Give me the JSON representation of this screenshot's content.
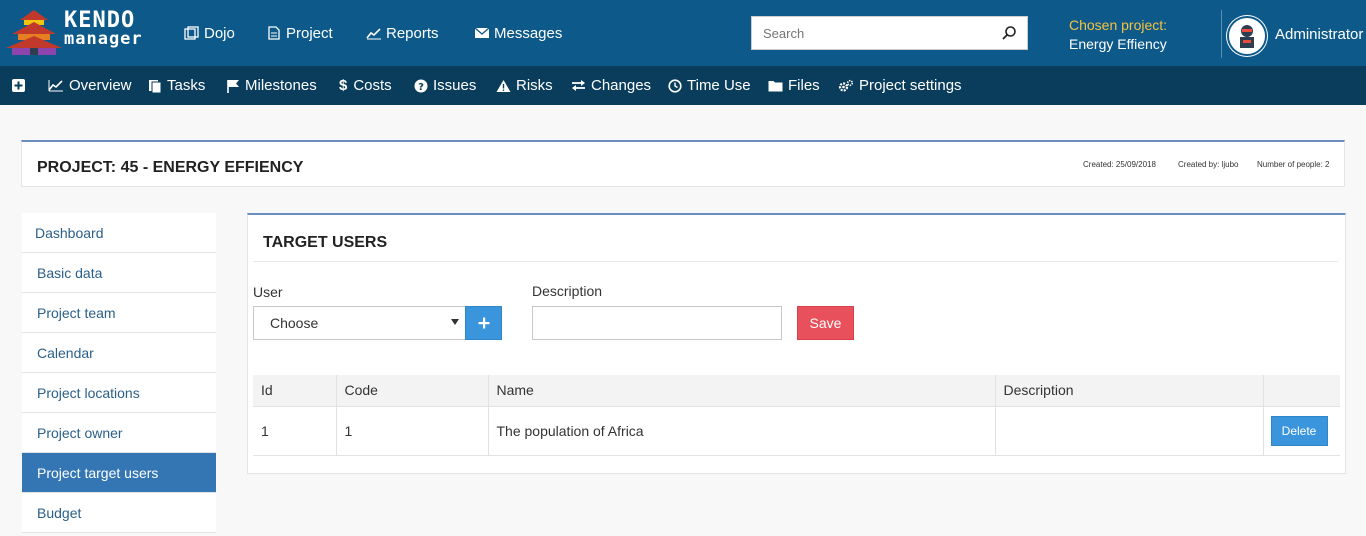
{
  "logo": {
    "line1": "KENDO",
    "line2": "manager"
  },
  "topnav": [
    {
      "label": "Dojo",
      "icon": "copy-icon"
    },
    {
      "label": "Project",
      "icon": "document-icon"
    },
    {
      "label": "Reports",
      "icon": "line-chart-icon"
    },
    {
      "label": "Messages",
      "icon": "envelope-icon"
    }
  ],
  "search": {
    "placeholder": "Search"
  },
  "chosen_project": {
    "label": "Chosen project:",
    "value": "Energy Effiency"
  },
  "user": {
    "name": "Administrator"
  },
  "subnav": [
    {
      "label": "Overview",
      "icon": "area-chart-icon"
    },
    {
      "label": "Tasks",
      "icon": "tasks-icon"
    },
    {
      "label": "Milestones",
      "icon": "flag-icon"
    },
    {
      "label": "Costs",
      "icon": "dollar-icon"
    },
    {
      "label": "Issues",
      "icon": "question-circle-icon"
    },
    {
      "label": "Risks",
      "icon": "warning-icon"
    },
    {
      "label": "Changes",
      "icon": "exchange-icon"
    },
    {
      "label": "Time Use",
      "icon": "clock-icon"
    },
    {
      "label": "Files",
      "icon": "folder-icon"
    },
    {
      "label": "Project settings",
      "icon": "cogs-icon"
    }
  ],
  "project": {
    "title": "PROJECT: 45 - ENERGY EFFIENCY",
    "created": "Created: 25/09/2018",
    "created_by": "Created by: ljubo",
    "people": "Number of people: 2"
  },
  "sidebar": [
    {
      "label": "Dashboard"
    },
    {
      "label": "Basic data"
    },
    {
      "label": "Project team"
    },
    {
      "label": "Calendar"
    },
    {
      "label": "Project locations"
    },
    {
      "label": "Project owner"
    },
    {
      "label": "Project target users",
      "active": true
    },
    {
      "label": "Budget"
    }
  ],
  "panel": {
    "title": "TARGET USERS",
    "user_label": "User",
    "user_select": "Choose",
    "description_label": "Description",
    "description_value": "",
    "save_label": "Save"
  },
  "table": {
    "headers": [
      "Id",
      "Code",
      "Name",
      "Description",
      ""
    ],
    "rows": [
      {
        "id": "1",
        "code": "1",
        "name": "The population of Africa",
        "description": "",
        "action": "Delete"
      }
    ]
  },
  "colors": {
    "topbar": "#0d5a8a",
    "subbar": "#0a3d5c",
    "accent_yellow": "#f5c242",
    "active_sidebar": "#3476b3",
    "primary_button": "#3b95dd",
    "save_button": "#e8505b"
  }
}
